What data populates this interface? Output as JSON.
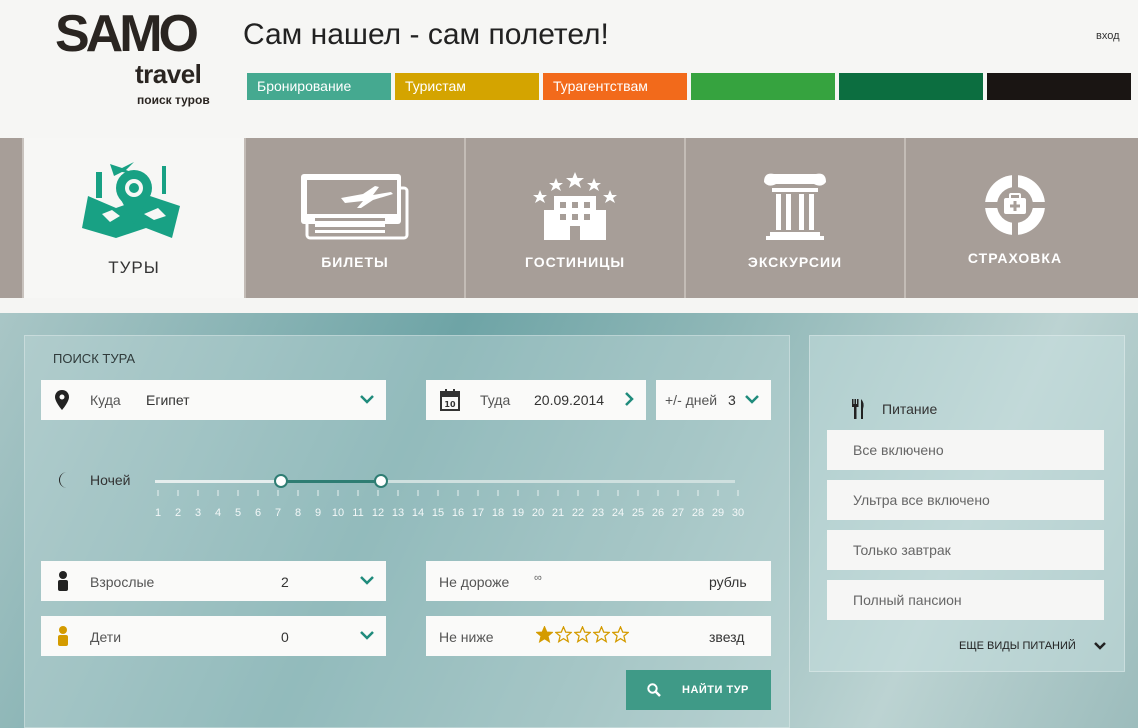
{
  "header": {
    "logo_main": "SAMO",
    "logo_travel": "travel",
    "logo_sub": "поиск туров",
    "slogan": "Сам нашел - сам полетел!",
    "login": "вход",
    "nav": [
      {
        "label": "Бронирование",
        "color": "#45a990"
      },
      {
        "label": "Туристам",
        "color": "#d4a400"
      },
      {
        "label": "Турагентствам",
        "color": "#f26a1b"
      },
      {
        "label": "",
        "color": "#36a33f"
      },
      {
        "label": "",
        "color": "#0c6e40"
      },
      {
        "label": "",
        "color": "#1a1513"
      }
    ]
  },
  "tabs": [
    {
      "label": "ТУРЫ",
      "icon": "tour-map-icon",
      "active": true
    },
    {
      "label": "БИЛЕТЫ",
      "icon": "ticket-icon",
      "active": false
    },
    {
      "label": "ГОСТИНИЦЫ",
      "icon": "hotel-icon",
      "active": false
    },
    {
      "label": "ЭКСКУРСИИ",
      "icon": "column-icon",
      "active": false
    },
    {
      "label": "СТРАХОВКА",
      "icon": "lifebuoy-icon",
      "active": false
    }
  ],
  "search": {
    "title": "ПОИСК ТУРА",
    "destination_label": "Куда",
    "destination_value": "Египет",
    "date_label": "Туда",
    "date_value": "20.09.2014",
    "days_label": "+/- дней",
    "days_value": "3",
    "nights_label": "Ночей",
    "nights_from": 7,
    "nights_to": 12,
    "night_ticks": [
      "1",
      "2",
      "3",
      "4",
      "5",
      "6",
      "7",
      "8",
      "9",
      "10",
      "11",
      "12",
      "13",
      "14",
      "15",
      "16",
      "17",
      "18",
      "19",
      "20",
      "21",
      "22",
      "23",
      "24",
      "25",
      "26",
      "27",
      "28",
      "29",
      "30"
    ],
    "adults_label": "Взрослые",
    "adults_value": "2",
    "children_label": "Дети",
    "children_value": "0",
    "price_label": "Не дороже",
    "price_value": "∞",
    "price_unit": "рубль",
    "stars_label": "Не ниже",
    "stars_value": 1,
    "stars_max": 5,
    "stars_unit": "звезд",
    "button": "НАЙТИ ТУР"
  },
  "food": {
    "title": "Питание",
    "options": [
      "Все включено",
      "Ультра все включено",
      "Только завтрак",
      "Полный пансион"
    ],
    "more": "ЕЩЕ ВИДЫ ПИТАНИЙ"
  },
  "colors": {
    "accent": "#2e9a87",
    "tab_bg": "#a79e98",
    "star": "#d49b00"
  }
}
